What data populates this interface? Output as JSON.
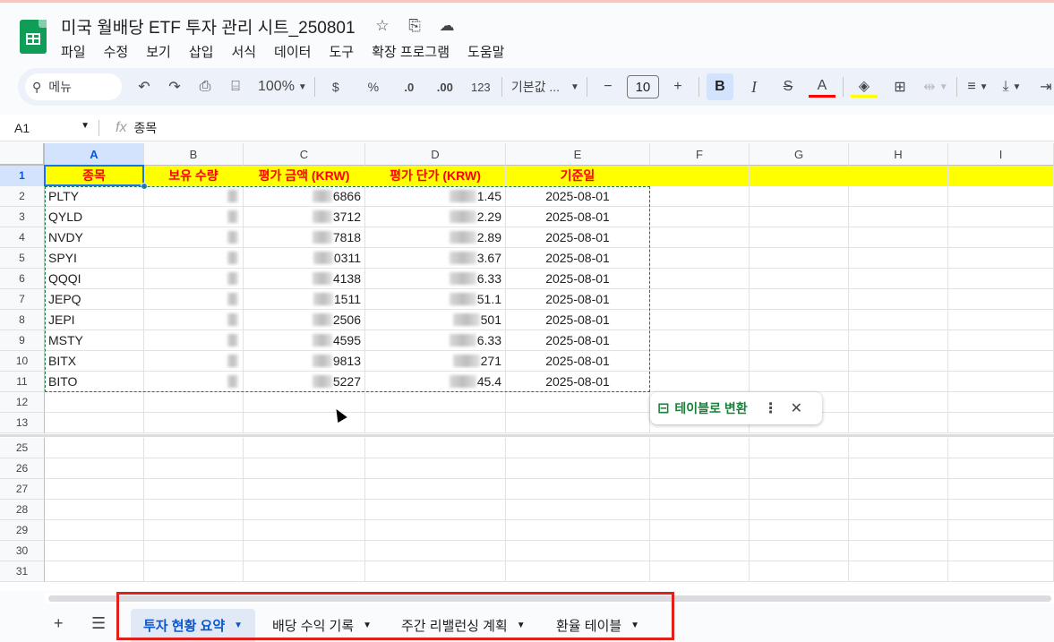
{
  "document": {
    "title": "미국 월배당 ETF 투자 관리 시트_250801"
  },
  "menu": [
    "파일",
    "수정",
    "보기",
    "삽입",
    "서식",
    "데이터",
    "도구",
    "확장 프로그램",
    "도움말"
  ],
  "toolbar": {
    "search_label": "메뉴",
    "zoom": "100%",
    "currency": "$",
    "percent": "%",
    "dec_decrease": ".0",
    "dec_increase": ".00",
    "number_format": "123",
    "font": "기본값 ...",
    "font_size": "10",
    "bold": "B",
    "italic": "I",
    "text_color": "A"
  },
  "formula_bar": {
    "cell_ref": "A1",
    "fx": "fx",
    "value": "종목"
  },
  "columns": [
    "A",
    "B",
    "C",
    "D",
    "E",
    "F",
    "G",
    "H",
    "I"
  ],
  "rows": [
    "1",
    "2",
    "3",
    "4",
    "5",
    "6",
    "7",
    "8",
    "9",
    "10",
    "11",
    "12",
    "13",
    "25",
    "26",
    "27",
    "28",
    "29",
    "30",
    "31"
  ],
  "headers": {
    "ticker": "종목",
    "quantity": "보유 수량",
    "valuation": "평가 금액 (KRW)",
    "unit_price": "평가 단가 (KRW)",
    "base_date": "기준일"
  },
  "table_rows": [
    {
      "ticker": "PLTY",
      "valuation_tail": "6866",
      "price_tail": "1.45",
      "date": "2025-08-01"
    },
    {
      "ticker": "QYLD",
      "valuation_tail": "3712",
      "price_tail": "2.29",
      "date": "2025-08-01"
    },
    {
      "ticker": "NVDY",
      "valuation_tail": "7818",
      "price_tail": "2.89",
      "date": "2025-08-01"
    },
    {
      "ticker": "SPYI",
      "valuation_tail": "0311",
      "price_tail": "3.67",
      "date": "2025-08-01"
    },
    {
      "ticker": "QQQI",
      "valuation_tail": "4138",
      "price_tail": "6.33",
      "date": "2025-08-01"
    },
    {
      "ticker": "JEPQ",
      "valuation_tail": "1511",
      "price_tail": "51.1",
      "date": "2025-08-01"
    },
    {
      "ticker": "JEPI",
      "valuation_tail": "2506",
      "price_tail": "501",
      "date": "2025-08-01"
    },
    {
      "ticker": "MSTY",
      "valuation_tail": "4595",
      "price_tail": "6.33",
      "date": "2025-08-01"
    },
    {
      "ticker": "BITX",
      "valuation_tail": "9813",
      "price_tail": "271",
      "date": "2025-08-01"
    },
    {
      "ticker": "BITO",
      "valuation_tail": "5227",
      "price_tail": "45.4",
      "date": "2025-08-01"
    }
  ],
  "table_chip": {
    "label": "테이블로 변환"
  },
  "sheet_tabs": [
    {
      "label": "투자 현황 요약",
      "active": true
    },
    {
      "label": "배당 수익 기록",
      "active": false
    },
    {
      "label": "주간 리밸런싱 계획",
      "active": false
    },
    {
      "label": "환율 테이블",
      "active": false
    }
  ],
  "colors": {
    "header_fill": "#ffff00",
    "header_text": "#ff0000",
    "accent": "#0b57d0",
    "logo": "#0f9d58",
    "highlight_box": "#e0201b"
  }
}
